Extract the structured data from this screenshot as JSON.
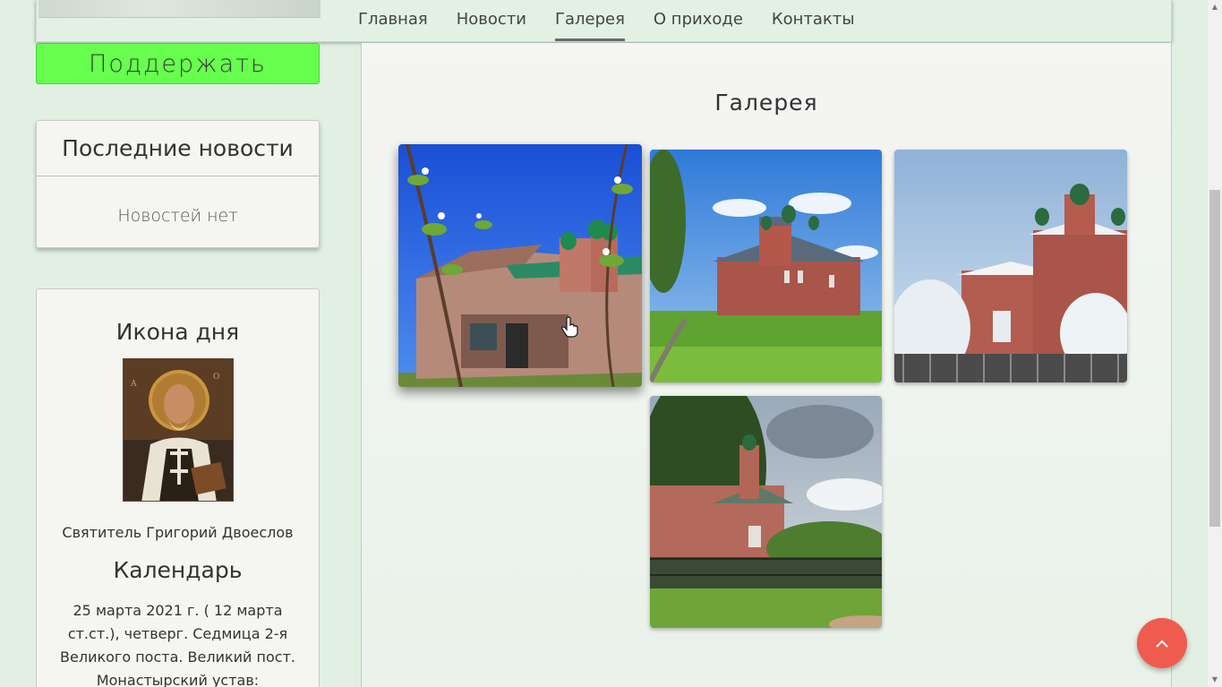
{
  "nav": {
    "items": [
      {
        "label": "Главная"
      },
      {
        "label": "Новости"
      },
      {
        "label": "Галерея",
        "active": true
      },
      {
        "label": "О приходе"
      },
      {
        "label": "Контакты"
      }
    ]
  },
  "sidebar": {
    "donate_label": "Поддержать",
    "news": {
      "title": "Последние новости",
      "empty": "Новостей нет"
    },
    "icon_of_day": {
      "title": "Икона дня",
      "saint": "Святитель Григорий Двоеслов"
    },
    "calendar": {
      "title": "Календарь",
      "text": "25 марта 2021 г. ( 12 марта ст.ст.), четверг. Седмица 2-я Великого поста. Великий пост. Монастырский устав:"
    }
  },
  "main": {
    "title": "Галерея",
    "photos": [
      {
        "subject": "church-spring-photo"
      },
      {
        "subject": "church-summer-photo"
      },
      {
        "subject": "church-winter-photo"
      },
      {
        "subject": "church-autumn-photo"
      }
    ]
  },
  "colors": {
    "background": "#e1f0e3",
    "donate": "#66ff4d",
    "to_top": "#ef5b4f"
  },
  "icons": {
    "to_top": "chevron-up-icon",
    "cursor": "hand-pointer-icon"
  }
}
